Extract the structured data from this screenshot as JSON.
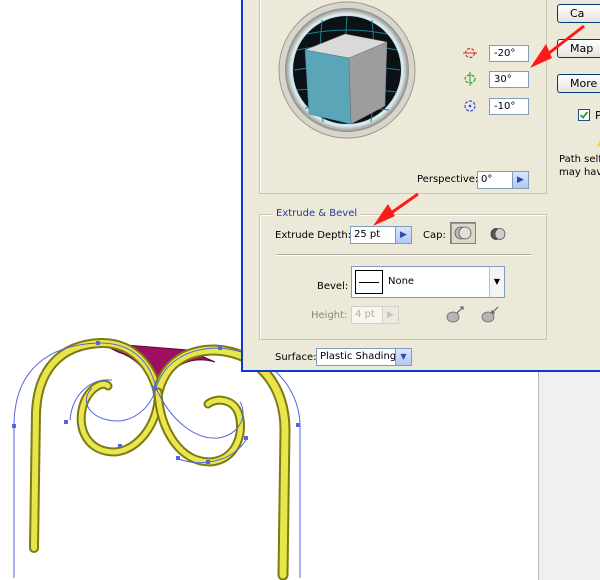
{
  "dialog": {
    "rotation": {
      "x_angle": "-20°",
      "y_angle": "30°",
      "z_angle": "-10°"
    },
    "perspective": {
      "label": "Perspective:",
      "value": "0°"
    },
    "extrude_bevel": {
      "legend": "Extrude & Bevel",
      "depth_label": "Extrude Depth:",
      "depth_value": "25 pt",
      "cap_label": "Cap:",
      "bevel_label": "Bevel:",
      "bevel_value": "None",
      "height_label": "Height:",
      "height_value": "4 pt"
    },
    "surface": {
      "label": "Surface:",
      "value": "Plastic Shading"
    },
    "buttons": {
      "cancel": "Ca",
      "map_art": "Map",
      "more_options": "More"
    },
    "preview_label": "P",
    "warning": {
      "line1": "Path self-i",
      "line2": "may have"
    }
  },
  "colors": {
    "dialog_bg": "#ece9d8",
    "dialog_border": "#0a3bd0",
    "cube_front": "#5aa5b8",
    "cube_top": "#d9d9d9",
    "cube_side": "#9d9d9d",
    "extrusion_yellow": "#d8d43a",
    "cap_magenta": "#9e0f62",
    "path_blue": "#5566dd",
    "arrow_red": "#ff1a1a"
  }
}
